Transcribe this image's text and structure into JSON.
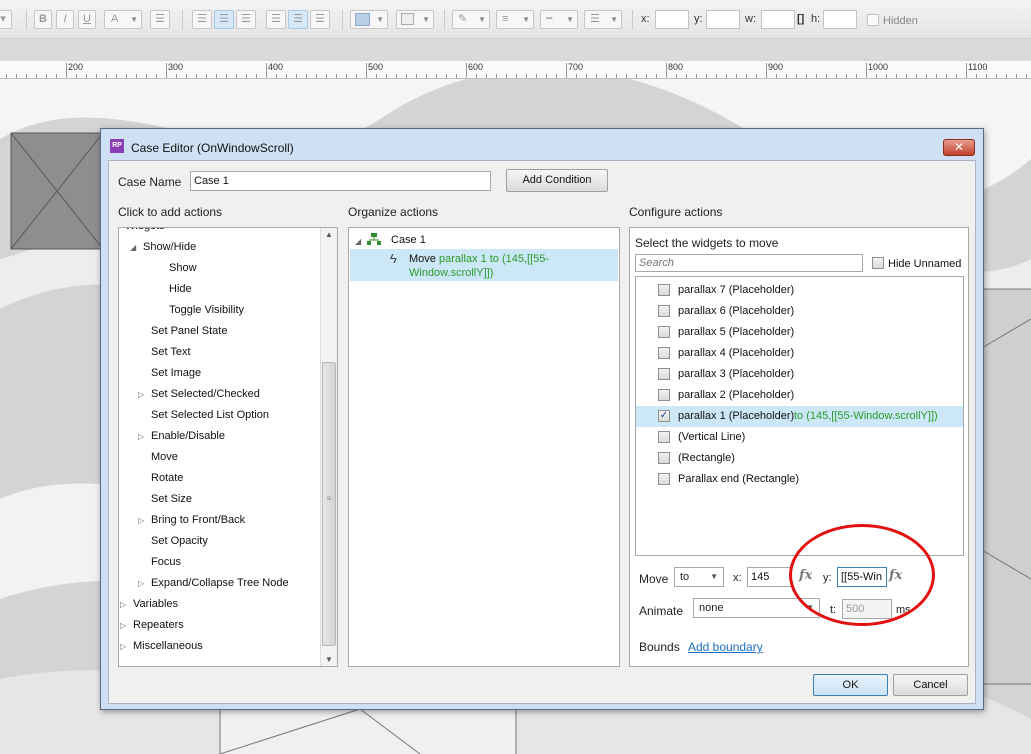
{
  "toolbar": {
    "bold": "B",
    "italic": "I",
    "underline": "U",
    "font_color": "A",
    "x_label": "x:",
    "y_label": "y:",
    "w_label": "w:",
    "h_label": "h:",
    "hidden_label": "Hidden"
  },
  "ruler": {
    "labels": [
      "200",
      "300",
      "400",
      "500",
      "600",
      "700",
      "800",
      "900",
      "1000",
      "1100"
    ]
  },
  "dialog": {
    "app_icon": "RP",
    "title": "Case Editor (OnWindowScroll)",
    "close_glyph": "✕",
    "case_name_label": "Case Name",
    "case_name_value": "Case 1",
    "add_condition_label": "Add Condition",
    "add_actions_header": "Click to add actions",
    "organize_header": "Organize actions",
    "configure_header": "Configure actions",
    "actions_tree": [
      {
        "label": "Widgets",
        "arrow": "▲"
      },
      {
        "label": "Show/Hide",
        "arrow": "◢"
      },
      {
        "label": "Show",
        "arrow": ""
      },
      {
        "label": "Hide",
        "arrow": ""
      },
      {
        "label": "Toggle Visibility",
        "arrow": ""
      },
      {
        "label": "Set Panel State",
        "arrow": ""
      },
      {
        "label": "Set Text",
        "arrow": ""
      },
      {
        "label": "Set Image",
        "arrow": ""
      },
      {
        "label": "Set Selected/Checked",
        "arrow": "▷"
      },
      {
        "label": "Set Selected List Option",
        "arrow": ""
      },
      {
        "label": "Enable/Disable",
        "arrow": "▷"
      },
      {
        "label": "Move",
        "arrow": ""
      },
      {
        "label": "Rotate",
        "arrow": ""
      },
      {
        "label": "Set Size",
        "arrow": ""
      },
      {
        "label": "Bring to Front/Back",
        "arrow": "▷"
      },
      {
        "label": "Set Opacity",
        "arrow": ""
      },
      {
        "label": "Focus",
        "arrow": ""
      },
      {
        "label": "Expand/Collapse Tree Node",
        "arrow": "▷"
      },
      {
        "label": "Variables",
        "arrow": "▷"
      },
      {
        "label": "Repeaters",
        "arrow": "▷"
      },
      {
        "label": "Miscellaneous",
        "arrow": "▷"
      }
    ],
    "organize": {
      "case_label": "Case 1",
      "action_verb": "Move",
      "action_detail_1": "parallax 1 to (145,[[55-",
      "action_detail_2": "Window.scrollY]])"
    },
    "configure": {
      "select_widgets_label": "Select the widgets to move",
      "search_placeholder": "Search",
      "hide_unnamed_label": "Hide Unnamed",
      "widgets": [
        {
          "label": "parallax 7 (Placeholder)",
          "checked": false,
          "detail": ""
        },
        {
          "label": "parallax 6 (Placeholder)",
          "checked": false,
          "detail": ""
        },
        {
          "label": "parallax 5 (Placeholder)",
          "checked": false,
          "detail": ""
        },
        {
          "label": "parallax 4 (Placeholder)",
          "checked": false,
          "detail": ""
        },
        {
          "label": "parallax 3 (Placeholder)",
          "checked": false,
          "detail": ""
        },
        {
          "label": "parallax 2 (Placeholder)",
          "checked": false,
          "detail": ""
        },
        {
          "label": "parallax 1 (Placeholder)",
          "checked": true,
          "detail": "to (145,[[55-Window.scrollY]])"
        },
        {
          "label": "(Vertical Line)",
          "checked": false,
          "detail": ""
        },
        {
          "label": "(Rectangle)",
          "checked": false,
          "detail": ""
        },
        {
          "label": "Parallax end (Rectangle)",
          "checked": false,
          "detail": ""
        }
      ],
      "move_label": "Move",
      "move_mode": "to",
      "x_label": "x:",
      "x_value": "145",
      "y_label": "y:",
      "y_value": "[[55-Win",
      "fx_label": "fx",
      "animate_label": "Animate",
      "animate_value": "none",
      "t_label": "t:",
      "t_value": "500",
      "ms_label": "ms",
      "bounds_label": "Bounds",
      "add_boundary_link": "Add boundary"
    },
    "ok_label": "OK",
    "cancel_label": "Cancel"
  },
  "colors": {
    "accent_link": "#1a6fc4",
    "green_text": "#2c9a2c",
    "selection": "#cce8f6",
    "annotation_circle": "#e31010"
  }
}
